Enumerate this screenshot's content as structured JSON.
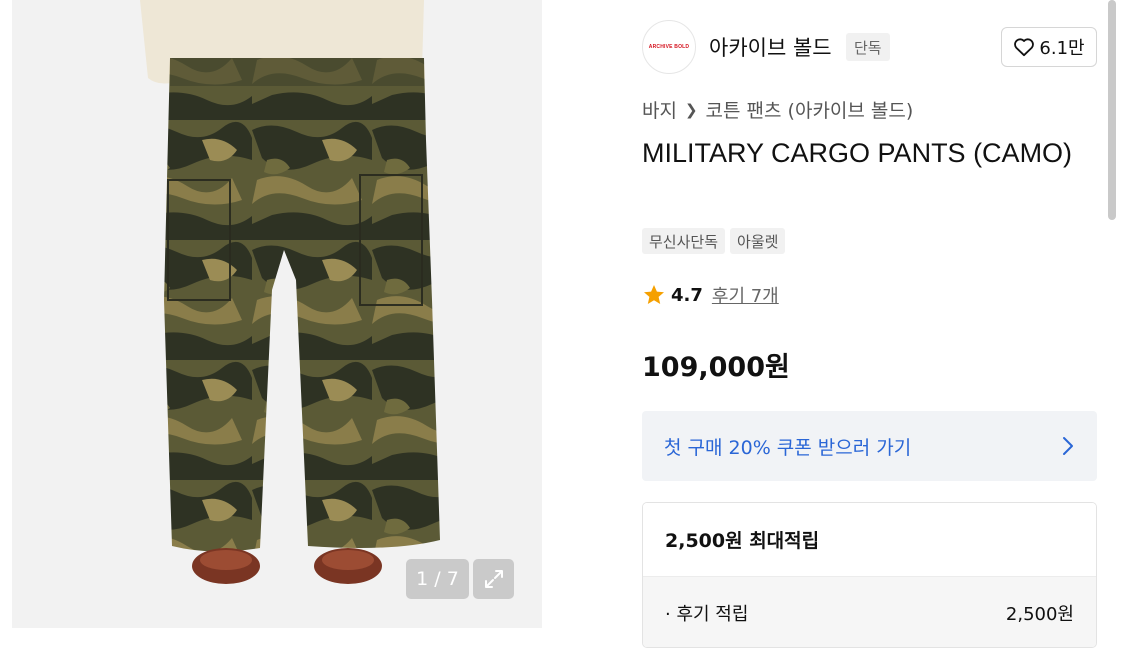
{
  "gallery": {
    "image_alt": "camo cargo pants model photo",
    "counter": "1 / 7",
    "expand_icon": "expand-icon"
  },
  "brand": {
    "logo_text": "ARCHIVE BOLD",
    "name": "아카이브 볼드",
    "badge": "단독",
    "like_icon": "heart-icon",
    "like_count": "6.1만"
  },
  "breadcrumb": {
    "category": "바지",
    "subcategory": "코튼 팬츠 (아카이브 볼드)"
  },
  "product": {
    "title": "MILITARY CARGO PANTS (CAMO)",
    "tags": [
      "무신사단독",
      "아울렛"
    ],
    "rating_score": "4.7",
    "reviews": "후기 7개",
    "price": "109,000원"
  },
  "coupon": {
    "label": "첫 구매 20% 쿠폰 받으러 가기"
  },
  "points": {
    "max_label": "2,500원 최대적립",
    "rows": [
      {
        "label": "· 후기 적립",
        "value": "2,500원"
      }
    ]
  },
  "colors": {
    "accent_blue": "#2a66d6",
    "star": "#f5a000",
    "brand_red": "#d4111d"
  }
}
